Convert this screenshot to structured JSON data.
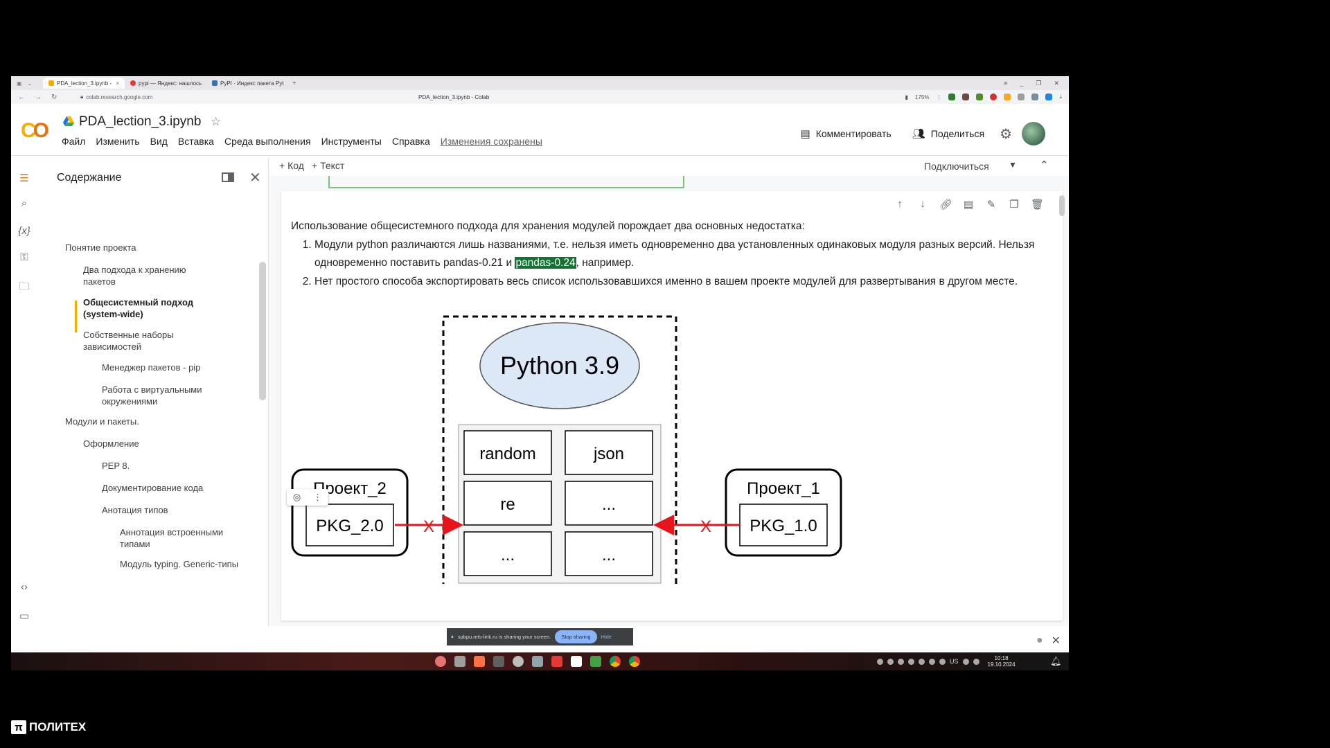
{
  "browser": {
    "tabs": [
      {
        "label": "PDA_lection_3.ipynb -",
        "favicon_color": "#f9ab00",
        "active": true
      },
      {
        "label": "pypi — Яндекс: нашлось",
        "favicon_color": "#e53935",
        "active": false
      },
      {
        "label": "PyPI · Индекс пакета Pyt",
        "favicon_color": "#3775a9",
        "active": false
      }
    ],
    "url": "colab.research.google.com",
    "page_title": "PDA_lection_3.ipynb - Colab",
    "zoom": "175%"
  },
  "notebook": {
    "name": "PDA_lection_3.ipynb",
    "menu": [
      "Файл",
      "Изменить",
      "Вид",
      "Вставка",
      "Среда выполнения",
      "Инструменты",
      "Справка"
    ],
    "saved_status": "Изменения сохранены",
    "comment_label": "Комментировать",
    "share_label": "Поделиться"
  },
  "toolbar": {
    "add_code": "+ Код",
    "add_text": "+ Текст",
    "connect": "Подключиться"
  },
  "sidebar": {
    "title": "Содержание",
    "items": [
      {
        "label": "Понятие проекта",
        "level": 1,
        "bold": false
      },
      {
        "label": "Два подхода к хранению пакетов",
        "level": 2,
        "bold": false
      },
      {
        "label": "Общесистемный подход (system-wide)",
        "level": 2,
        "bold": true
      },
      {
        "label": "Собственные наборы зависимостей",
        "level": 2,
        "bold": false
      },
      {
        "label": "Менеджер пакетов - pip",
        "level": 3,
        "bold": false
      },
      {
        "label": "Работа с виртуальными окружениями",
        "level": 3,
        "bold": false
      },
      {
        "label": "Модули и пакеты.",
        "level": 1,
        "bold": false
      },
      {
        "label": "Оформление",
        "level": 2,
        "bold": false
      },
      {
        "label": "PEP 8.",
        "level": 3,
        "bold": false
      },
      {
        "label": "Документирование кода",
        "level": 3,
        "bold": false
      },
      {
        "label": "Анотация типов",
        "level": 3,
        "bold": false
      },
      {
        "label": "Аннотация встроенными типами",
        "level": 4,
        "bold": false
      },
      {
        "label": "Модуль typing. Generic-типы",
        "level": 4,
        "bold": false
      }
    ]
  },
  "cell": {
    "intro": "Использование общесистемного подхода для хранения модулей порождает два основных недостатка:",
    "item1_part1": "Модули python различаются лишь названиями, т.е. нельзя иметь одновременно два установленных одинаковых модуля разных версий. Нельзя одновременно поставить pandas-0.21 и ",
    "item1_highlight": "pandas-0.24",
    "item1_part2": ", например.",
    "item2": "Нет простого способа экспортировать весь список использовавшихся именно в вашем проекте модулей для развертывания в другом месте."
  },
  "diagram": {
    "python_label": "Python 3.9",
    "modules": [
      "random",
      "json",
      "re",
      "...",
      "...",
      "..."
    ],
    "project_left": {
      "name": "Проект_2",
      "pkg": "PKG_2.0"
    },
    "project_right": {
      "name": "Проект_1",
      "pkg": "PKG_1.0"
    },
    "blocked_mark": "X",
    "ellipse_color": "#dce8f6",
    "arrow_color": "#e8141b"
  },
  "screenshare": {
    "message": "spbpu.mts-link.ru is sharing your screen.",
    "stop_label": "Stop sharing",
    "hide_label": "Hide"
  },
  "taskbar": {
    "lang": "US",
    "time": "10:18",
    "date": "19.10.2024"
  },
  "brand": {
    "name": "ПОЛИТЕХ"
  }
}
